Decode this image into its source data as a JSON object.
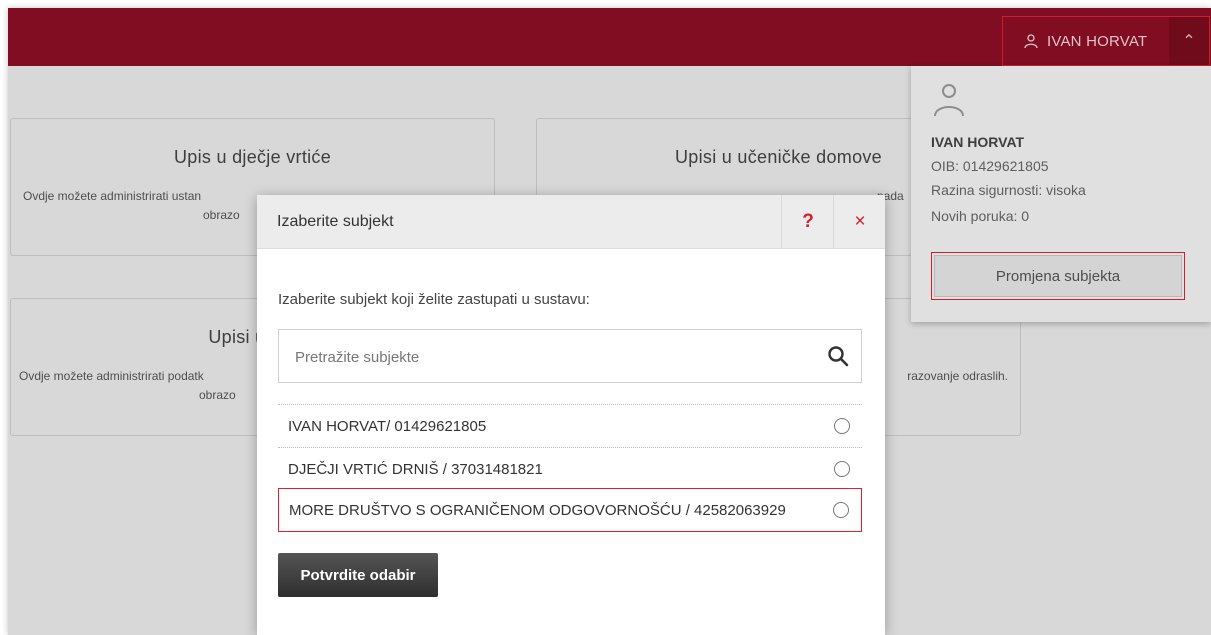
{
  "header": {
    "user_name": "IVAN HORVAT",
    "brand_color": "#8b0f24",
    "highlight_color": "#e1202d"
  },
  "cards": [
    {
      "title": "Upis u dječje vrtiće",
      "text_line1": "Ovdje možete administrirati ustan",
      "text_line2": "obrazo"
    },
    {
      "title": "Upisi u učeničke domove",
      "text_line1": "pada"
    },
    {
      "title": "Upisi u sre",
      "text_line1": "Ovdje možete administrirati podatk",
      "text_line2": "obrazo"
    },
    {
      "text_line1": "razovanje odraslih."
    }
  ],
  "dropdown": {
    "name": "IVAN HORVAT",
    "oib": "OIB: 01429621805",
    "security_level": "Razina sigurnosti: visoka",
    "messages": "Novih poruka: 0",
    "change_subject_label": "Promjena subjekta"
  },
  "modal": {
    "title": "Izaberite subjekt",
    "help_label": "?",
    "close_label": "×",
    "instruction": "Izaberite subjekt koji želite zastupati u sustavu:",
    "search_placeholder": "Pretražite subjekte",
    "options": [
      {
        "label": "IVAN HORVAT/ 01429621805",
        "selected": false
      },
      {
        "label": "DJEČJI VRTIĆ DRNIŠ / 37031481821",
        "selected": false
      },
      {
        "label": "MORE DRUŠTVO S OGRANIČENOM ODGOVORNOŠĆU / 42582063929",
        "selected": false
      }
    ],
    "confirm_label": "Potvrdite odabir"
  }
}
